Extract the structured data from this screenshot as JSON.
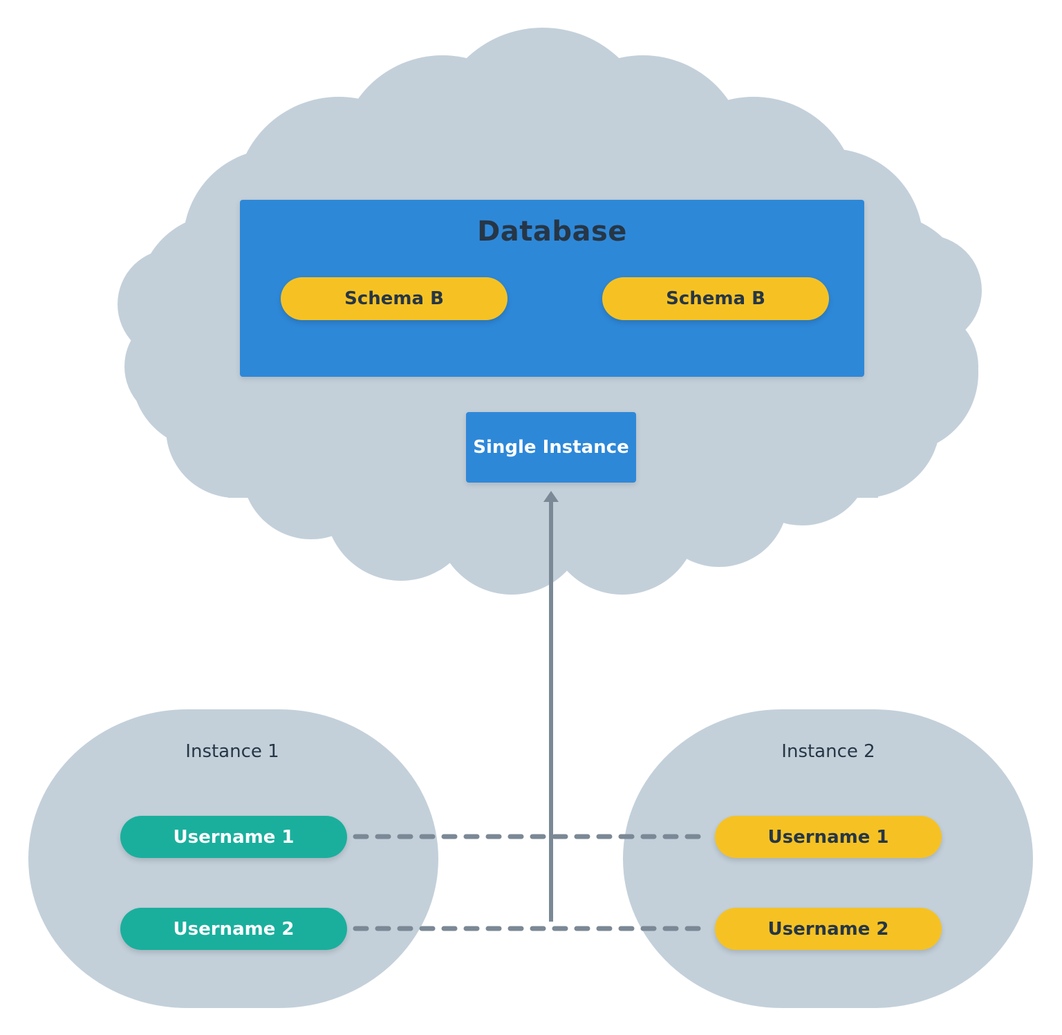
{
  "colors": {
    "cloud": "#c3d0da",
    "database_blue": "#2e88d8",
    "schema_yellow": "#f6c223",
    "username_teal": "#1aaf9d",
    "username_yellow": "#f6c223",
    "connector_gray": "#7b8895",
    "dark_text": "#263646"
  },
  "cloud": {
    "database": {
      "title": "Database",
      "schemas": [
        {
          "label": "Schema B"
        },
        {
          "label": "Schema B"
        }
      ]
    },
    "single_instance": {
      "label": "Single Instance"
    }
  },
  "instances": [
    {
      "label": "Instance 1",
      "usernames": [
        {
          "label": "Username 1"
        },
        {
          "label": "Username 2"
        }
      ]
    },
    {
      "label": "Instance 2",
      "usernames": [
        {
          "label": "Username 1"
        },
        {
          "label": "Username 2"
        }
      ]
    }
  ],
  "connectors": {
    "dashed_links": [
      {
        "from": "Instance 1 / Username 1",
        "to": "Instance 2 / Username 1"
      },
      {
        "from": "Instance 1 / Username 2",
        "to": "Instance 2 / Username 2"
      }
    ],
    "arrow": {
      "from": "Username 2 link",
      "to": "Single Instance"
    }
  }
}
